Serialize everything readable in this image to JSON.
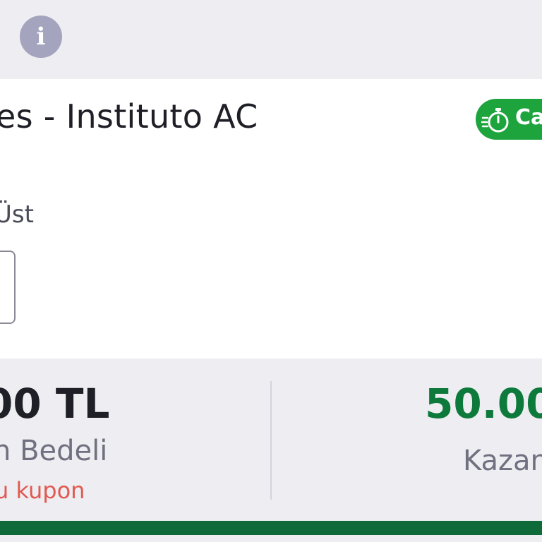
{
  "header": {
    "info_icon": "info-icon",
    "info_glyph": "i"
  },
  "bet": {
    "match_title": "es - Instituto AC",
    "status_icon": "stopwatch-icon",
    "status_text": "Ca",
    "status_color": "#1ea43c",
    "market_label": "Üst"
  },
  "summary": {
    "stake_amount": "00 TL",
    "stake_label": "n Bedeli",
    "coupon_note": "u kupon",
    "winnings_amount": "50.00",
    "winnings_label": "Kazan",
    "accent_color": "#0d7a3c",
    "warning_color": "#e05a52"
  },
  "progress": {
    "fraction": 1.0,
    "color": "#0f6a3a"
  }
}
